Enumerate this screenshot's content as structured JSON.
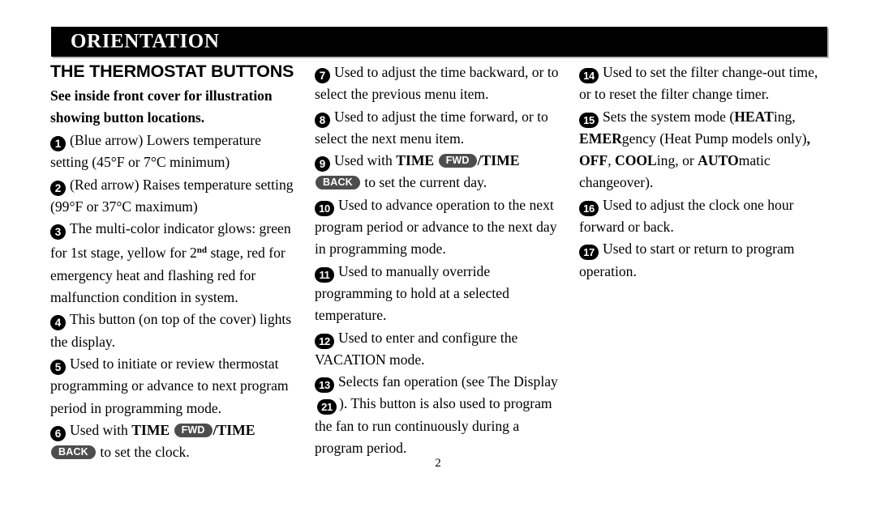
{
  "header": {
    "band_title": "ORIENTATION",
    "band_color": "#000000",
    "band_text_color": "#ffffff"
  },
  "section": {
    "heading": "THE THERMOSTAT BUTTONS",
    "intro_line_1": "See inside front cover for illustration",
    "intro_line_2": "showing button locations."
  },
  "glyphs": {
    "fwd": "FWD",
    "back": "BACK",
    "pill_color": "#4d4d4d",
    "marker_color": "#000000"
  },
  "columns": [
    {
      "id": "column-1",
      "items": [
        {
          "number": "1",
          "parts": [
            {
              "type": "text",
              "value": "(Blue arrow) Lowers temperature setting (45°F or 7°C minimum)"
            }
          ]
        },
        {
          "number": "2",
          "parts": [
            {
              "type": "text",
              "value": "(Red arrow) Raises temperature setting (99°F or 37°C maximum)"
            }
          ]
        },
        {
          "number": "3",
          "parts": [
            {
              "type": "text",
              "value": "The multi-color indicator glows: green for 1st stage, yellow for 2"
            },
            {
              "type": "sup",
              "value": "nd"
            },
            {
              "type": "text",
              "value": " stage, red for emergency heat and flashing red for malfunction condition in system."
            }
          ]
        },
        {
          "number": "4",
          "parts": [
            {
              "type": "text",
              "value": "This button (on top of the cover) lights the display."
            }
          ]
        },
        {
          "number": "5",
          "parts": [
            {
              "type": "text",
              "value": "Used to initiate or review thermostat programming or advance to next program period in programming mode."
            }
          ]
        },
        {
          "number": "6",
          "parts": [
            {
              "type": "text",
              "value": "Used with "
            },
            {
              "type": "bold",
              "value": "TIME"
            },
            {
              "type": "text",
              "value": " "
            },
            {
              "type": "pill",
              "value": "FWD"
            },
            {
              "type": "bold",
              "value": "/TIME"
            },
            {
              "type": "text",
              "value": " "
            },
            {
              "type": "pill",
              "value": "BACK"
            },
            {
              "type": "text",
              "value": " to set the clock."
            }
          ]
        }
      ]
    },
    {
      "id": "column-2",
      "items": [
        {
          "number": "7",
          "parts": [
            {
              "type": "text",
              "value": "Used to adjust the time backward, or to select the previous menu item."
            }
          ]
        },
        {
          "number": "8",
          "parts": [
            {
              "type": "text",
              "value": "Used to adjust the time forward, or to select the next menu item."
            }
          ]
        },
        {
          "number": "9",
          "parts": [
            {
              "type": "text",
              "value": "Used with "
            },
            {
              "type": "bold",
              "value": "TIME"
            },
            {
              "type": "text",
              "value": " "
            },
            {
              "type": "pill",
              "value": "FWD"
            },
            {
              "type": "bold",
              "value": "/TIME"
            },
            {
              "type": "text",
              "value": " "
            },
            {
              "type": "pill",
              "value": "BACK"
            },
            {
              "type": "text",
              "value": " to set the current day."
            }
          ]
        },
        {
          "number": "10",
          "parts": [
            {
              "type": "text",
              "value": "Used to advance operation to the next program period or advance to the next day in programming mode."
            }
          ]
        },
        {
          "number": "11",
          "parts": [
            {
              "type": "text",
              "value": "Used to manually override programming to hold at a selected temperature."
            }
          ]
        },
        {
          "number": "12",
          "parts": [
            {
              "type": "text",
              "value": "Used to enter and configure the VACATION mode."
            }
          ]
        },
        {
          "number": "13",
          "parts": [
            {
              "type": "text",
              "value": "Selects fan operation (see The Display "
            },
            {
              "type": "marker_ref",
              "value": "21"
            },
            {
              "type": "text",
              "value": "). This button is also used to program the fan to run continuously during a program period."
            }
          ]
        }
      ]
    },
    {
      "id": "column-3",
      "items": [
        {
          "number": "14",
          "parts": [
            {
              "type": "text",
              "value": "Used to set the filter change-out time, or to reset the filter change timer."
            }
          ]
        },
        {
          "number": "15",
          "parts": [
            {
              "type": "text",
              "value": "Sets the system mode ("
            },
            {
              "type": "bold",
              "value": "HEAT"
            },
            {
              "type": "text",
              "value": "ing, "
            },
            {
              "type": "bold",
              "value": "EMER"
            },
            {
              "type": "text",
              "value": "gency (Heat Pump models only)"
            },
            {
              "type": "bold",
              "value": ", "
            },
            {
              "type": "bold",
              "value": "OFF"
            },
            {
              "type": "text",
              "value": ", "
            },
            {
              "type": "bold",
              "value": "COOL"
            },
            {
              "type": "text",
              "value": "ing, or "
            },
            {
              "type": "bold",
              "value": "AUTO"
            },
            {
              "type": "text",
              "value": "matic changeover)."
            }
          ]
        },
        {
          "number": "16",
          "parts": [
            {
              "type": "text",
              "value": "Used to adjust the clock one hour forward or back."
            }
          ]
        },
        {
          "number": "17",
          "parts": [
            {
              "type": "text",
              "value": "Used to start or return to program operation."
            }
          ]
        }
      ]
    }
  ],
  "footer": {
    "page_number": "2"
  }
}
